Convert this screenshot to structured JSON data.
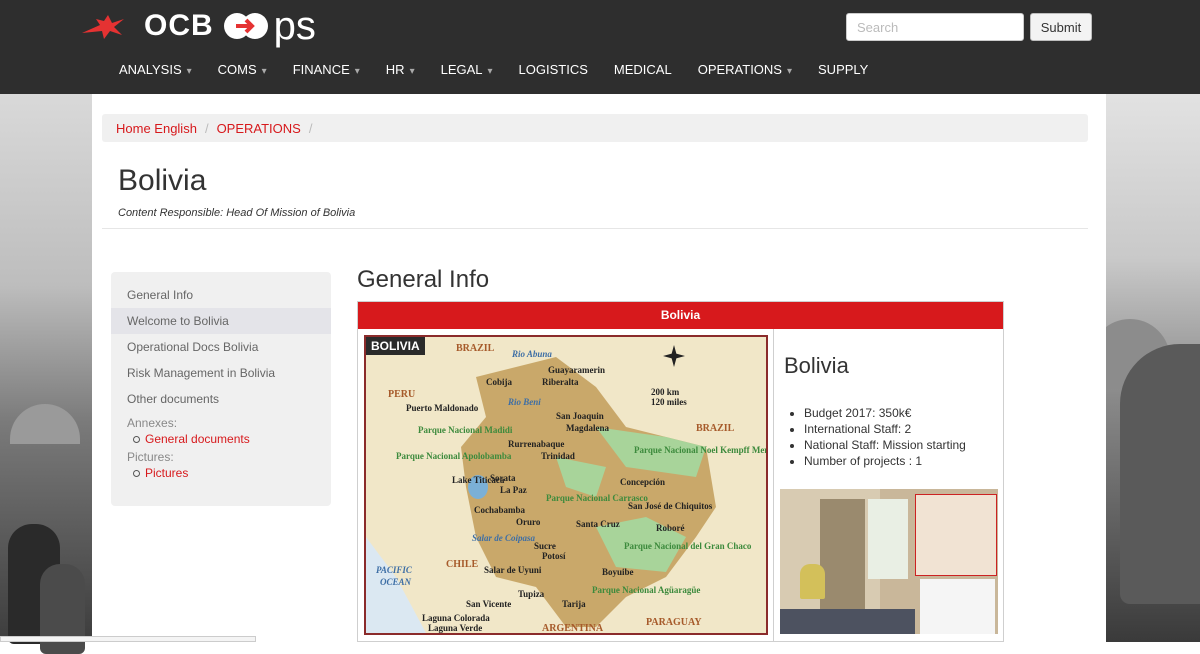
{
  "navbar": {
    "logo_text": "OCB",
    "logo_suffix": "ps",
    "search_placeholder": "Search",
    "submit_label": "Submit",
    "menu": [
      {
        "label": "ANALYSIS",
        "dropdown": true
      },
      {
        "label": "COMS",
        "dropdown": true
      },
      {
        "label": "FINANCE",
        "dropdown": true
      },
      {
        "label": "HR",
        "dropdown": true
      },
      {
        "label": "LEGAL",
        "dropdown": true
      },
      {
        "label": "LOGISTICS",
        "dropdown": false
      },
      {
        "label": "MEDICAL",
        "dropdown": false
      },
      {
        "label": "OPERATIONS",
        "dropdown": true
      },
      {
        "label": "SUPPLY",
        "dropdown": false
      }
    ]
  },
  "breadcrumb": [
    "Home English",
    "OPERATIONS"
  ],
  "page": {
    "title": "Bolivia",
    "responsible": "Content Responsible: Head Of Mission of Bolivia"
  },
  "sidenav": {
    "items": [
      "General Info",
      "Welcome to Bolivia",
      "Operational Docs Bolivia",
      "Risk Management in Bolivia",
      "Other documents"
    ],
    "active_index": 1,
    "annexes_label": "Annexes:",
    "annexes_link": "General documents",
    "pictures_label": "Pictures:",
    "pictures_link": "Pictures"
  },
  "section": {
    "title": "General Info",
    "table_header": "Bolivia",
    "map_title": "BOLIVIA",
    "country_title": "Bolivia",
    "facts": [
      "Budget 2017: 350k€",
      "International Staff: 2",
      "National Staff: Mission starting",
      "Number of projects : 1"
    ]
  },
  "map_labels": {
    "brazil_top": "BRAZIL",
    "brazil_right": "BRAZIL",
    "peru": "PERU",
    "chile": "CHILE",
    "argentina": "ARGENTINA",
    "paraguay": "PARAGUAY",
    "pacific": "PACIFIC",
    "ocean": "OCEAN",
    "scale_km": "200 km",
    "scale_miles": "120 miles",
    "cities": [
      "Cobija",
      "Guayaramerin",
      "Riberalta",
      "Puerto Maldonado",
      "San Joaquin",
      "Magdalena",
      "Rurrenabaque",
      "Trinidad",
      "Sorata",
      "La Paz",
      "Concepción",
      "Cochabamba",
      "Oruro",
      "Santa Cruz",
      "San José de Chiquitos",
      "Roboré",
      "Sucre",
      "Potosí",
      "Salar de Uyuni",
      "Boyuibe",
      "Tupiza",
      "Tarija",
      "San Vicente",
      "Laguna Colorada",
      "Laguna Verde"
    ],
    "parks": [
      "Parque Nacional Madidi",
      "Parque Nacional Apolobamba",
      "Parque Nacional Noel Kempff Mercado",
      "Parque Nacional Carrasco",
      "Parque Nacional del Gran Chaco",
      "Parque Nacional Agüaragüe"
    ],
    "lake": "Lake Titicaca",
    "salar_coipasa": "Salar de Coipasa",
    "river_abuna": "Rio Abuna",
    "river_beni": "Rio Beni"
  },
  "colors": {
    "navbar_bg": "#2e2e2e",
    "accent_red": "#d7191c",
    "sidenav_bg": "#f0f0f0"
  }
}
